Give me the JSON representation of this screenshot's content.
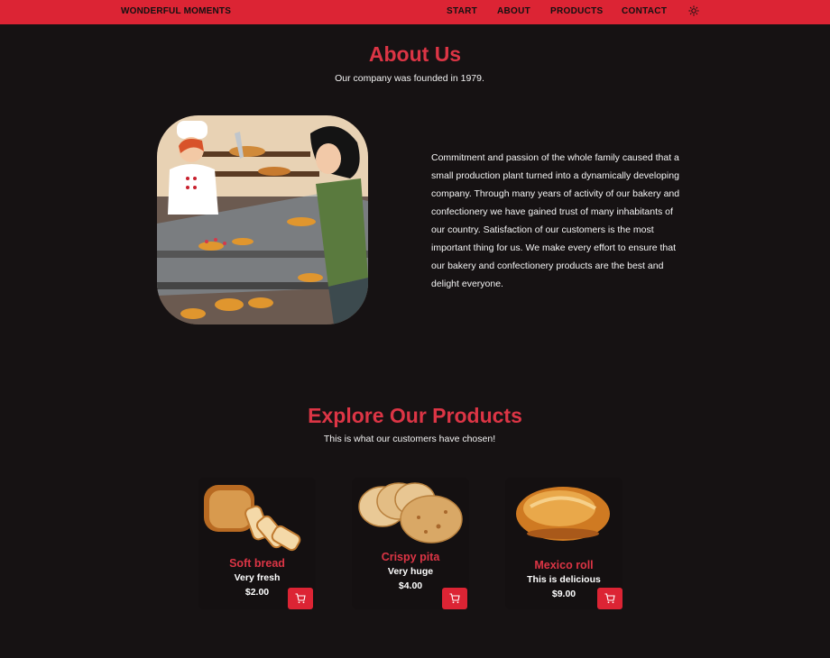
{
  "brand": "WONDERFUL MOMENTS",
  "nav": [
    "START",
    "ABOUT",
    "PRODUCTS",
    "CONTACT"
  ],
  "theme_toggle_icon": "sun-icon",
  "about": {
    "title": "About Us",
    "subtitle": "Our company was founded in 1979.",
    "text": "Commitment and passion of the whole family caused that a small production plant turned into a dynamically developing company. Through many years of activity of our bakery and confectionery we have gained trust of many inhabitants of our country. Satisfaction of our customers is the most important thing for us. We make every effort to ensure that our bakery and confectionery products are the best and delight everyone."
  },
  "products": {
    "title": "Explore Our Products",
    "subtitle": "This is what our customers have chosen!",
    "items": [
      {
        "name": "Soft bread",
        "desc": "Very fresh",
        "price": "$2.00"
      },
      {
        "name": "Crispy pita",
        "desc": "Very huge",
        "price": "$4.00"
      },
      {
        "name": "Mexico roll",
        "desc": "This is delicious",
        "price": "$9.00"
      }
    ]
  },
  "colors": {
    "accent": "#dc2434",
    "background": "#161213",
    "heading": "#dc3545"
  }
}
